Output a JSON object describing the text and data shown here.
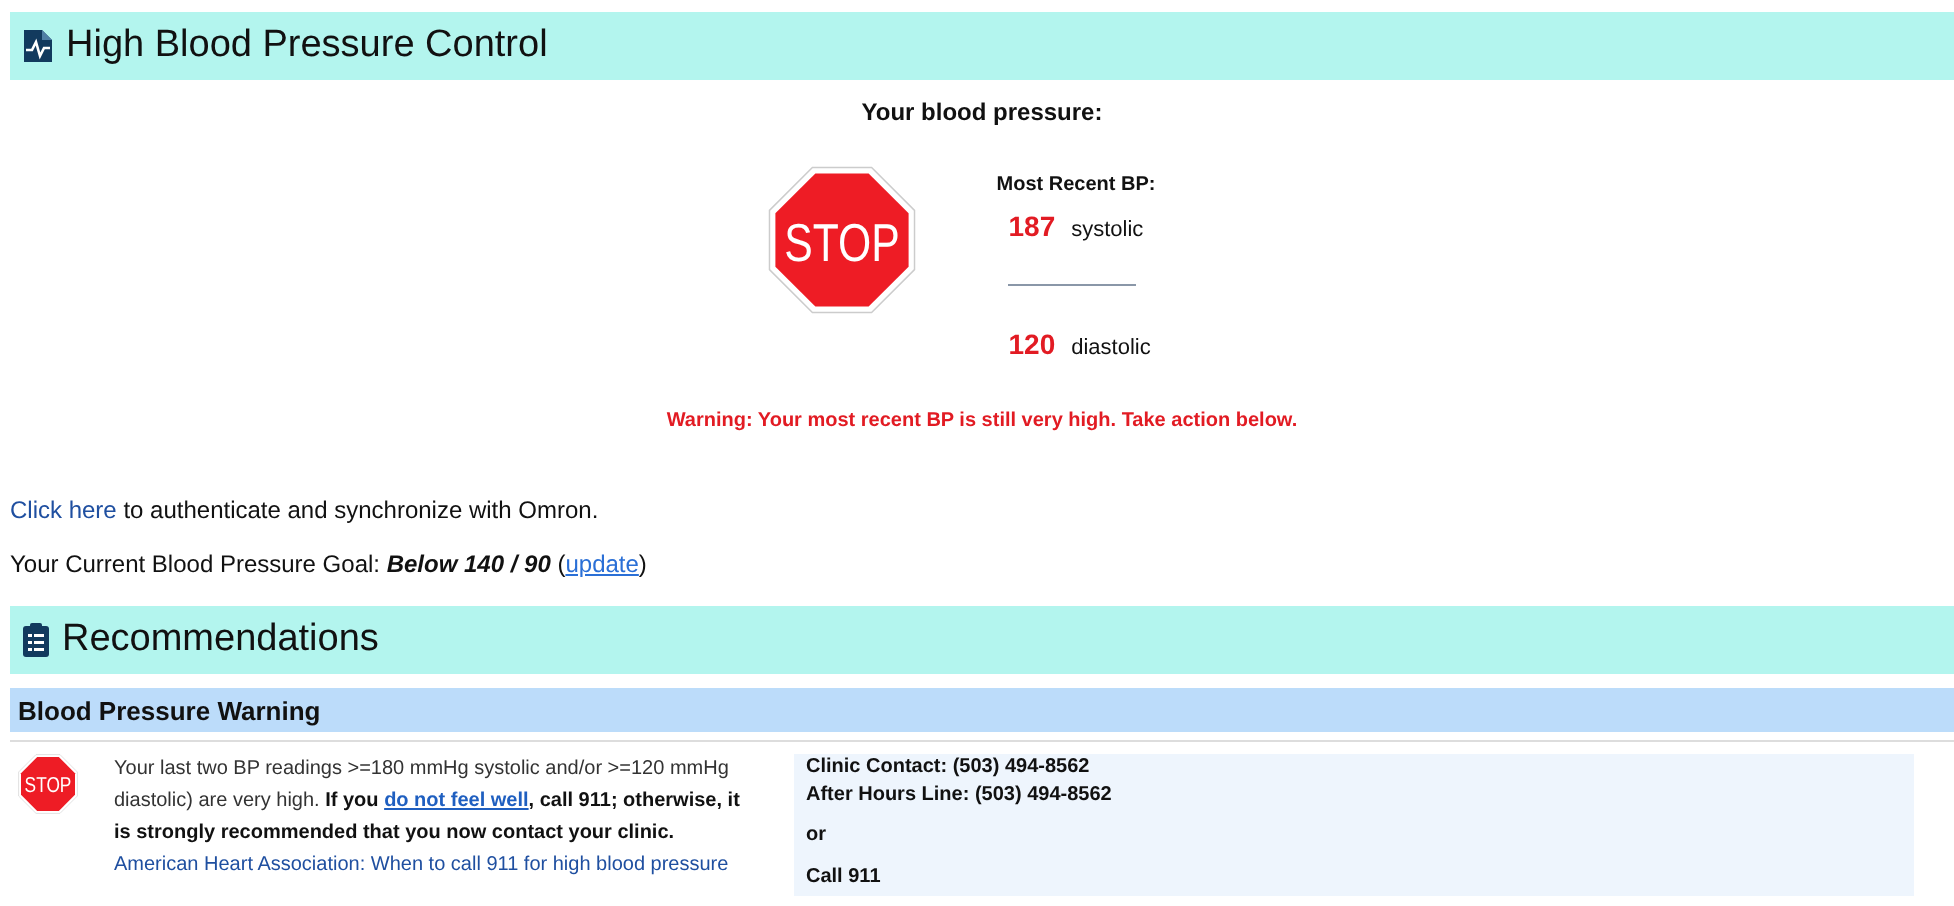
{
  "header": {
    "title": "High Blood Pressure Control"
  },
  "bp": {
    "heading": "Your blood pressure:",
    "sign": "STOP",
    "recent_label": "Most Recent BP:",
    "systolic": {
      "value": "187",
      "label": "systolic"
    },
    "diastolic": {
      "value": "120",
      "label": "diastolic"
    },
    "warning": "Warning: Your most recent BP is still very high. Take action below."
  },
  "sync": {
    "link": "Click here",
    "text": " to authenticate and synchronize with Omron."
  },
  "goal": {
    "text": "Your Current Blood Pressure Goal: **Below 140 / 90** (",
    "link": "update",
    "after": ")"
  },
  "recommendations": {
    "title": "Recommendations",
    "section": "Blood Pressure Warning",
    "card": {
      "sign": "STOP",
      "text_before": "Your last two BP readings >=180 mmHg systolic and/or >=120 mmHg diastolic) are very high. **If you** ",
      "link": "do not feel well",
      "text_after": "**, call 911; otherwise, it is strongly recommended that you now contact your clinic.**",
      "aha_link": "American Heart Association: When to call 911 for high blood pressure",
      "contacts": [
        "Clinic Contact: (503) 494-8562",
        "After Hours Line: (503) 494-8562",
        "or",
        "Call 911"
      ]
    }
  }
}
